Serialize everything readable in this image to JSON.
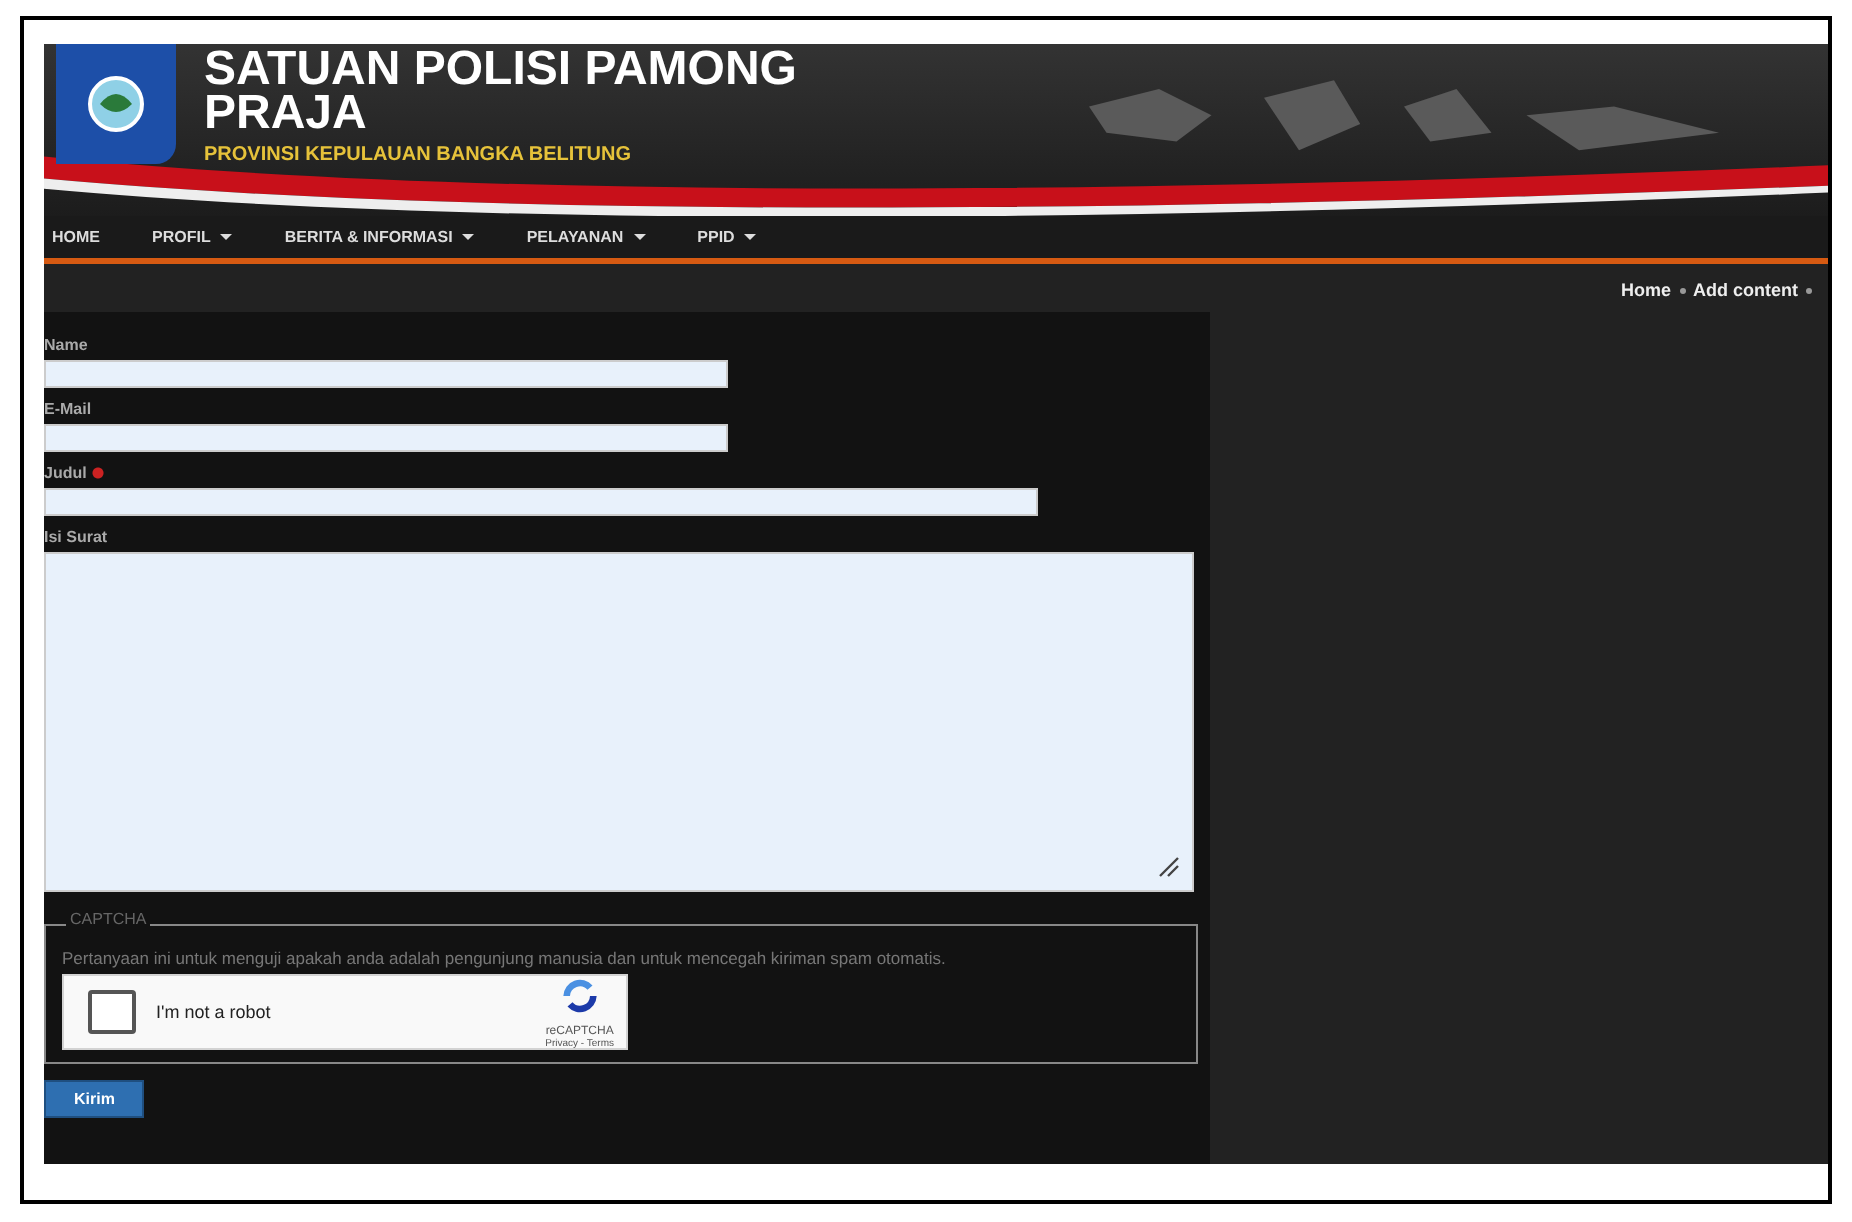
{
  "header": {
    "title": "SATUAN POLISI PAMONG PRAJA",
    "subtitle": "PROVINSI KEPULAUAN BANGKA BELITUNG"
  },
  "menu": [
    {
      "label": "HOME",
      "dropdown": false
    },
    {
      "label": "PROFIL",
      "dropdown": true
    },
    {
      "label": "BERITA & INFORMASI",
      "dropdown": true
    },
    {
      "label": "PELAYANAN",
      "dropdown": true
    },
    {
      "label": "PPID",
      "dropdown": true
    }
  ],
  "breadcrumb": [
    "Home",
    "Add content"
  ],
  "form": {
    "fields": [
      {
        "label": "Name",
        "required": false,
        "kind": "short"
      },
      {
        "label": "E-Mail",
        "required": false,
        "kind": "short"
      },
      {
        "label": "Judul",
        "required": true,
        "kind": "long"
      },
      {
        "label": "Isi Surat",
        "required": false,
        "kind": "area"
      }
    ],
    "captcha": {
      "legend": "CAPTCHA",
      "description": "Pertanyaan ini untuk menguji apakah anda adalah pengunjung manusia dan untuk mencegah kiriman spam otomatis.",
      "checkbox_label": "I'm not a robot",
      "checked": false,
      "brand": "reCAPTCHA",
      "links": "Privacy - Terms"
    },
    "submit": "Kirim"
  }
}
